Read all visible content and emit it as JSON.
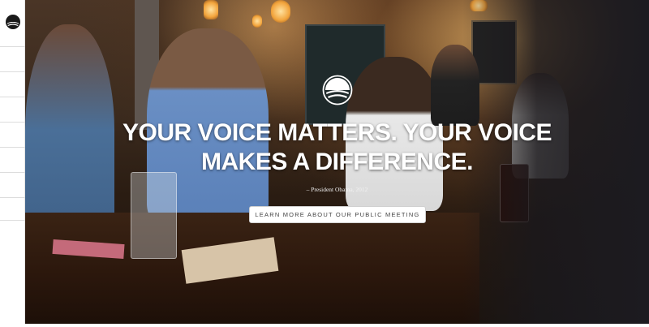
{
  "brand": {
    "logo_icon": "obama-foundation-logo-icon"
  },
  "nav_rail": {
    "slots": 8
  },
  "hero": {
    "headline_line1": "YOUR VOICE MATTERS. YOUR VOICE",
    "headline_line2": "MAKES A DIFFERENCE.",
    "attribution": "– President Obama, 2012",
    "cta_label": "LEARN MORE ABOUT OUR PUBLIC MEETING"
  },
  "colors": {
    "headline": "#ffffff",
    "cta_bg": "#ffffff",
    "cta_text": "#444444"
  }
}
